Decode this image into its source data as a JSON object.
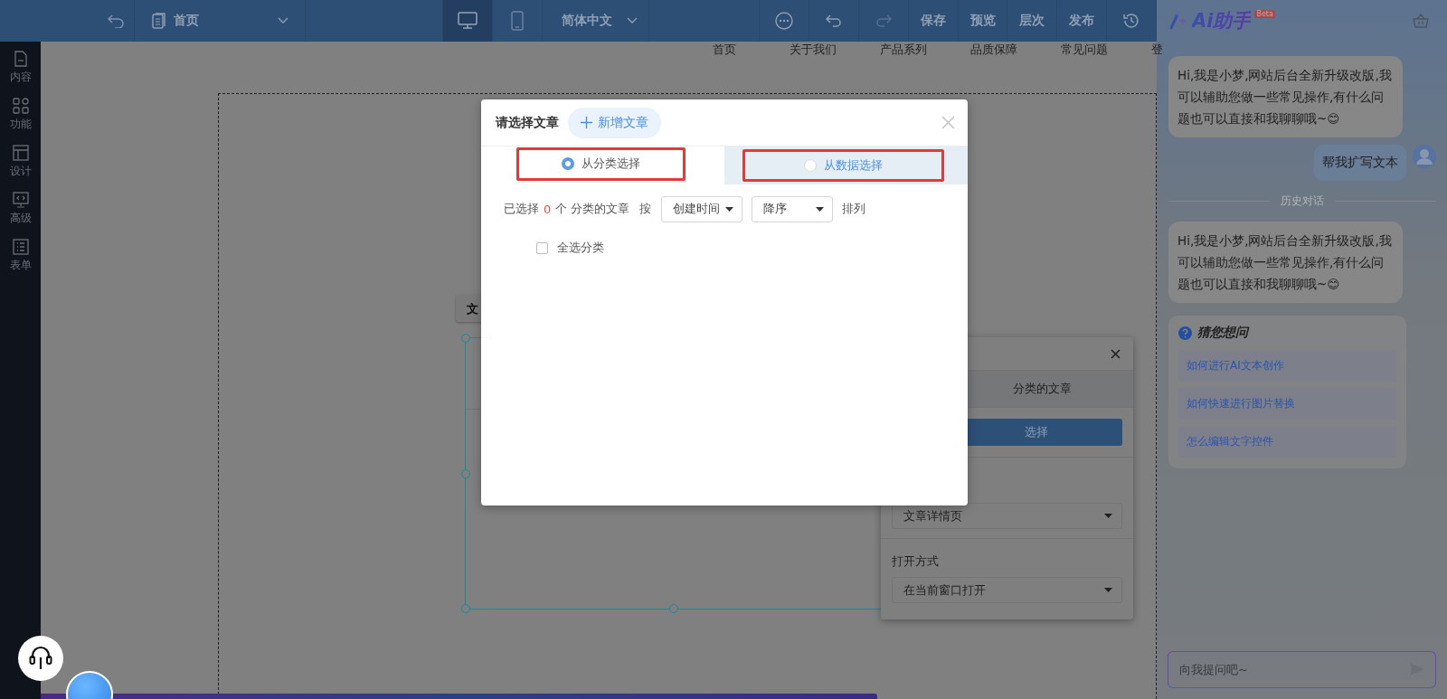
{
  "toolbar": {
    "page_select": "首页",
    "language": "简体中文",
    "devices": [
      {
        "kind": "desktop",
        "selected": true
      },
      {
        "kind": "mobile",
        "selected": false
      }
    ],
    "history": [
      {
        "kind": "undo",
        "disabled": false
      },
      {
        "kind": "redo",
        "disabled": true
      }
    ],
    "actions": [
      "保存",
      "预览",
      "层次",
      "发布"
    ]
  },
  "sidebar": {
    "items": [
      {
        "kind": "content",
        "label": "内容"
      },
      {
        "kind": "function",
        "label": "功能"
      },
      {
        "kind": "design",
        "label": "设计"
      },
      {
        "kind": "advanced",
        "label": "高级"
      },
      {
        "kind": "form",
        "label": "表单"
      }
    ]
  },
  "site_nav": [
    "首页",
    "关于我们",
    "产品系列",
    "品质保障",
    "常见问题",
    "登"
  ],
  "element_tab": "文",
  "property_panel": {
    "summary": "分类的文章",
    "select_button": "选择",
    "detail_page": "文章详情页",
    "open_label": "打开方式",
    "open_mode": "在当前窗口打开"
  },
  "dialog": {
    "title": "请选择文章",
    "add_button": "新增文章",
    "tabs": [
      {
        "label": "从分类选择",
        "selected": true
      },
      {
        "label": "从数据选择",
        "selected": false
      }
    ],
    "summary": {
      "prefix": "已选择",
      "count": "0",
      "suffix": "个 分类的文章"
    },
    "sort_by": "按",
    "sort_field": "创建时间",
    "sort_order": "降序",
    "sort_suffix": "排列",
    "select_all": {
      "label": "全选分类",
      "checked": false
    }
  },
  "assistant": {
    "title": "Ai助手",
    "badge": "Beta",
    "messages": [
      {
        "kind": "bot",
        "text": "Hi,我是小梦,网站后台全新升级改版,我可以辅助您做一些常见操作,有什么问题也可以直接和我聊聊哦~😊"
      },
      {
        "kind": "user",
        "text": "帮我扩写文本"
      },
      {
        "kind": "divider",
        "text": "历史对话"
      },
      {
        "kind": "bot",
        "text": "Hi,我是小梦,网站后台全新升级改版,我可以辅助您做一些常见操作,有什么问题也可以直接和我聊聊哦~😊"
      }
    ],
    "suggestions": {
      "title": "猜您想问",
      "items": [
        "如何进行AI文本创作",
        "如何快速进行图片替换",
        "怎么编辑文字控件"
      ]
    },
    "input": {
      "placeholder": "向我提问吧~"
    }
  }
}
